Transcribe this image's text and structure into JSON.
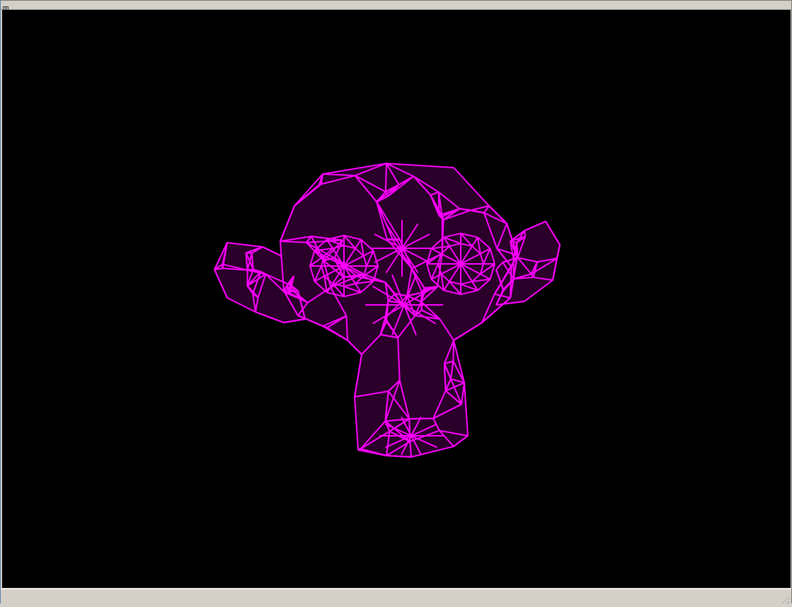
{
  "window": {
    "title": "",
    "background": "#000000"
  },
  "mesh": {
    "icon": "suzanne-monkey-wireframe",
    "edge_color": "#ff00ff",
    "fill_color": "#2a002a"
  },
  "statusbar": {
    "text": ""
  }
}
